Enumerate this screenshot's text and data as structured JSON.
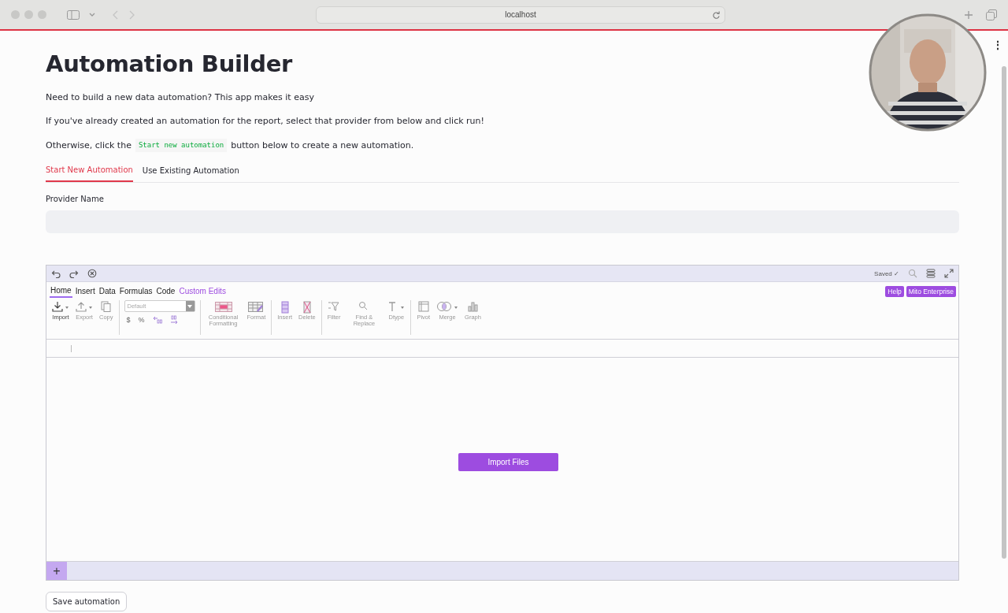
{
  "browser": {
    "address": "localhost"
  },
  "page_menu": {
    "label": "⋮"
  },
  "title": "Automation Builder",
  "intro": [
    "Need to build a new data automation? This app makes it easy",
    "If you've already created an automation for the report, select that provider from below and click run!"
  ],
  "instruction": {
    "before": "Otherwise, click the",
    "code": "Start new automation",
    "after": "button below to create a new automation."
  },
  "tabs": [
    {
      "label": "Start New Automation",
      "selected": true
    },
    {
      "label": "Use Existing Automation",
      "selected": false
    }
  ],
  "provider_field": {
    "label": "Provider Name"
  },
  "sheet": {
    "status": "Saved ✓",
    "menu": [
      {
        "label": "Home",
        "selected": true,
        "kind": "plain"
      },
      {
        "label": "Insert",
        "selected": false,
        "kind": "plain"
      },
      {
        "label": "Data",
        "selected": false,
        "kind": "plain"
      },
      {
        "label": "Formulas",
        "selected": false,
        "kind": "plain"
      },
      {
        "label": "Code",
        "selected": false,
        "kind": "plain"
      },
      {
        "label": "Custom Edits",
        "selected": false,
        "kind": "accent"
      }
    ],
    "badges": [
      "Help",
      "Mito Enterprise"
    ],
    "tools": [
      [
        {
          "label": "Import",
          "disabled": false
        },
        {
          "label": "Export",
          "disabled": true
        },
        {
          "label": "Copy",
          "disabled": true
        }
      ],
      [
        {
          "label": "Default",
          "disabled": true,
          "kind": "select"
        }
      ],
      [
        {
          "label": "Conditional Formatting",
          "disabled": true
        },
        {
          "label": "Format",
          "disabled": true
        }
      ],
      [
        {
          "label": "Insert",
          "disabled": true
        },
        {
          "label": "Delete",
          "disabled": true
        }
      ],
      [
        {
          "label": "Filter",
          "disabled": true
        },
        {
          "label": "Find & Replace",
          "disabled": true
        },
        {
          "label": "Dtype",
          "disabled": true
        }
      ],
      [
        {
          "label": "Pivot",
          "disabled": true
        },
        {
          "label": "Merge",
          "disabled": true
        },
        {
          "label": "Graph",
          "disabled": true
        }
      ]
    ],
    "number_format": [
      "$",
      "%"
    ],
    "import_button": "Import Files",
    "add_sheet": "+"
  },
  "save_button": "Save automation",
  "webcam": {
    "kind": "picture"
  }
}
